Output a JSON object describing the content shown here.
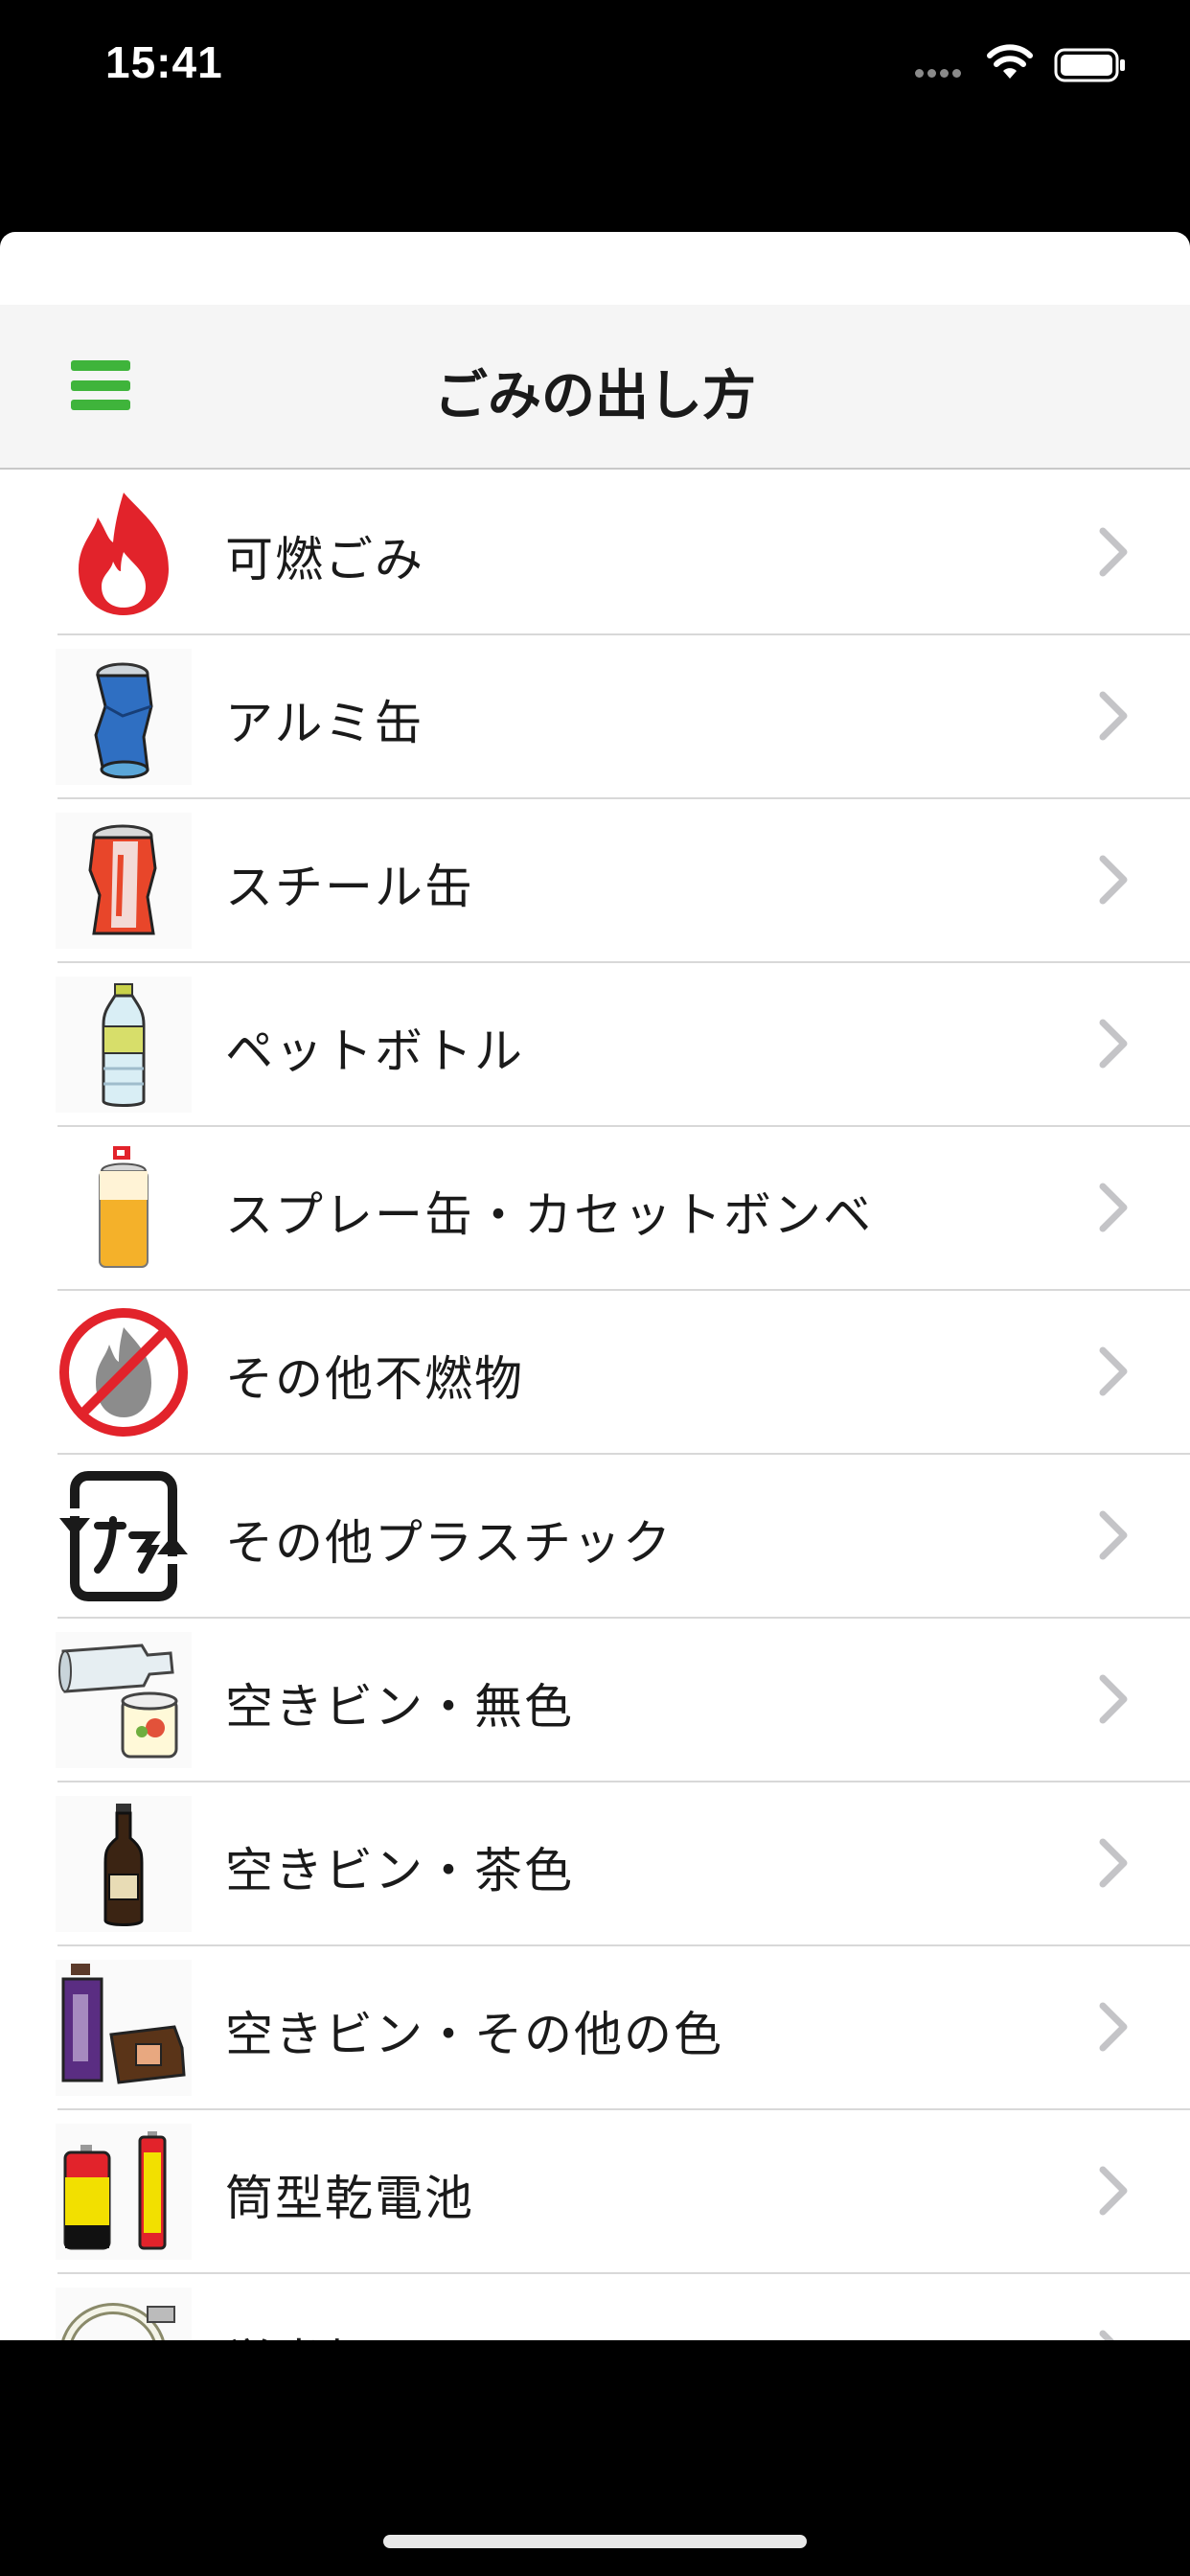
{
  "status_bar": {
    "time": "15:41"
  },
  "nav": {
    "title": "ごみの出し方",
    "menu_icon": "hamburger-menu-icon"
  },
  "items": [
    {
      "label": "可燃ごみ",
      "icon": "flame-icon"
    },
    {
      "label": "アルミ缶",
      "icon": "aluminum-can-icon"
    },
    {
      "label": "スチール缶",
      "icon": "steel-can-icon"
    },
    {
      "label": "ペットボトル",
      "icon": "pet-bottle-icon"
    },
    {
      "label": "スプレー缶・カセットボンベ",
      "icon": "spray-can-icon"
    },
    {
      "label": "その他不燃物",
      "icon": "no-burn-icon"
    },
    {
      "label": "その他プラスチック",
      "icon": "plastic-recycle-icon"
    },
    {
      "label": "空きビン・無色",
      "icon": "clear-bottle-icon"
    },
    {
      "label": "空きビン・茶色",
      "icon": "brown-bottle-icon"
    },
    {
      "label": "空きビン・その他の色",
      "icon": "other-color-bottle-icon"
    },
    {
      "label": "筒型乾電池",
      "icon": "battery-cells-icon"
    },
    {
      "label": "蛍光灯",
      "icon": "fluorescent-lamp-icon"
    }
  ],
  "colors": {
    "accent": "#3fb43b",
    "flame": "#e2232b"
  }
}
